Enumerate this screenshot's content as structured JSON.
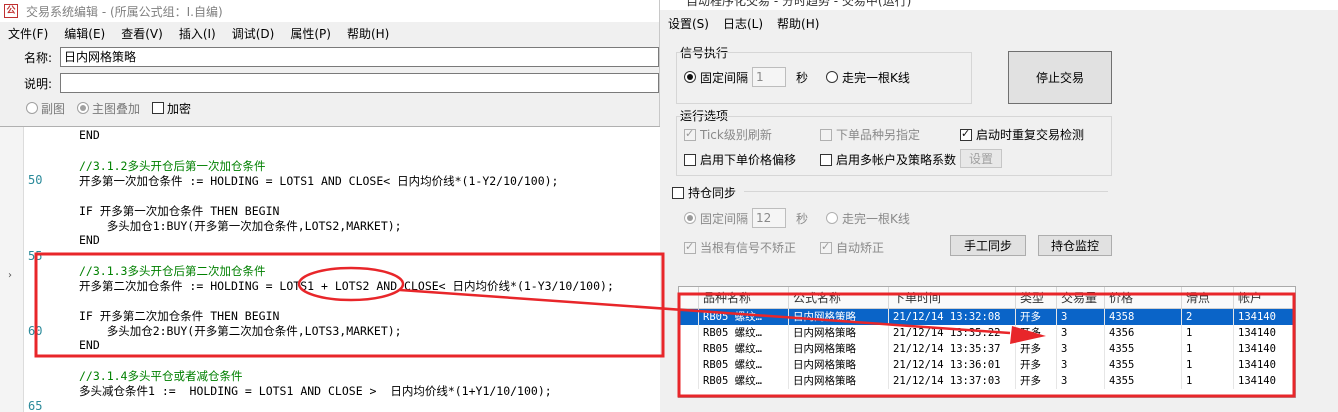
{
  "editor": {
    "title": "交易系统编辑 - (所属公式组：I.自编)",
    "menu": [
      "文件(F)",
      "编辑(E)",
      "查看(V)",
      "插入(I)",
      "调试(D)",
      "属性(P)",
      "帮助(H)"
    ],
    "name_label": "名称:",
    "name_value": "日内网格策略",
    "desc_label": "说明:",
    "desc_value": "",
    "options": {
      "sub_chart": "副图",
      "main_overlay": "主图叠加",
      "encrypt": "加密"
    },
    "line_numbers": [
      {
        "n": "50"
      },
      {
        "n": "55"
      },
      {
        "n": "60"
      },
      {
        "n": "65"
      }
    ],
    "code": [
      "END",
      "",
      "//3.1.2多头开仓后第一次加仓条件",
      "开多第一次加仓条件 := HOLDING = LOTS1 AND CLOSE< 日内均价线*(1-Y2/10/100);",
      "",
      "IF 开多第一次加仓条件 THEN BEGIN",
      "    多头加仓1:BUY(开多第一次加仓条件,LOTS2,MARKET);",
      "END",
      "",
      "//3.1.3多头开仓后第二次加仓条件",
      "开多第二次加仓条件 := HOLDING = LOTS1 + LOTS2 AND CLOSE< 日内均价线*(1-Y3/10/100);",
      "",
      "IF 开多第二次加仓条件 THEN BEGIN",
      "    多头加仓2:BUY(开多第二次加仓条件,LOTS3,MARKET);",
      "END",
      "",
      "//3.1.4多头平仓或者减仓条件",
      "多头减仓条件1 :=  HOLDING = LOTS1 AND CLOSE >  日内均价线*(1+Y1/10/100);"
    ]
  },
  "trade": {
    "title": "自动程序化交易 - 分时趋势 - 交易中(运行)",
    "menu": [
      "设置(S)",
      "日志(L)",
      "帮助(H)"
    ],
    "signal_group": "信号执行",
    "fixed_interval": "固定间隔",
    "interval_value": "1",
    "seconds": "秒",
    "per_bar": "走完一根K线",
    "stop_button": "停止交易",
    "run_group": "运行选项",
    "tick_refresh": "Tick级别刷新",
    "order_type": "下单品种另指定",
    "startup_check": "启动时重复交易检测",
    "price_offset": "启用下单价格偏移",
    "multi_account": "启用多帐户及策略系数",
    "settings_button": "设置",
    "sync_group": "持仓同步",
    "sync_interval_value": "12",
    "no_fix": "当根有信号不矫正",
    "auto_fix": "自动矫正",
    "manual_sync": "手工同步",
    "position_monitor": "持仓监控",
    "table": {
      "headers": [
        "",
        "品种名称",
        "公式名称",
        "下单时间",
        "类型",
        "交易量",
        "价格",
        "滑点",
        "帐户"
      ],
      "rows": [
        [
          "",
          "RB05 螺纹…",
          "日内网格策略",
          "21/12/14 13:32:08",
          "开多",
          "3",
          "4358",
          "2",
          "134140"
        ],
        [
          "",
          "RB05 螺纹…",
          "日内网格策略",
          "21/12/14 13:35:22",
          "开多",
          "3",
          "4356",
          "1",
          "134140"
        ],
        [
          "",
          "RB05 螺纹…",
          "日内网格策略",
          "21/12/14 13:35:37",
          "开多",
          "3",
          "4355",
          "1",
          "134140"
        ],
        [
          "",
          "RB05 螺纹…",
          "日内网格策略",
          "21/12/14 13:36:01",
          "开多",
          "3",
          "4355",
          "1",
          "134140"
        ],
        [
          "",
          "RB05 螺纹…",
          "日内网格策略",
          "21/12/14 13:37:03",
          "开多",
          "3",
          "4355",
          "1",
          "134140"
        ]
      ]
    }
  },
  "colors": {
    "annotation": "#e8262a",
    "selection": "#0a64c8",
    "keyword": "#0000c8",
    "comment": "#008000"
  }
}
